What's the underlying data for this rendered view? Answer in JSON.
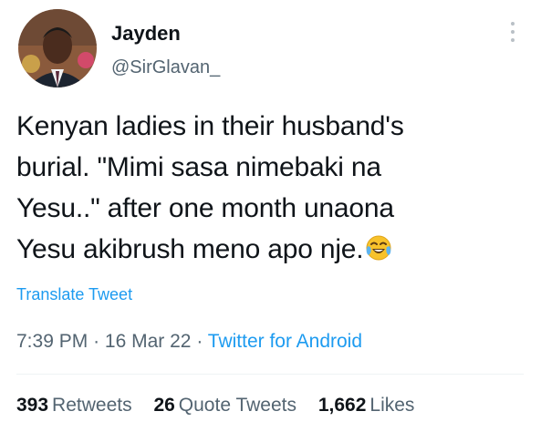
{
  "author": {
    "name": "Jayden",
    "handle": "@SirGlavan_",
    "avatar_icon": "profile-photo"
  },
  "more_icon": "vertical-dots-icon",
  "tweet": {
    "lines": [
      "Kenyan ladies in their husband's",
      "burial. \"Mimi sasa nimebaki na",
      "Yesu..\" after one month unaona",
      "Yesu akibrush meno apo nje."
    ],
    "emoji": "face-with-tears-of-joy"
  },
  "translate_label": "Translate Tweet",
  "meta": {
    "time": "7:39 PM",
    "separator": "·",
    "date": "16 Mar 22",
    "source": "Twitter for Android"
  },
  "stats": {
    "retweets_count": "393",
    "retweets_label": "Retweets",
    "quotes_count": "26",
    "quotes_label": "Quote Tweets",
    "likes_count": "1,662",
    "likes_label": "Likes"
  },
  "colors": {
    "text": "#0f1419",
    "secondary": "#536471",
    "link": "#1d9bf0",
    "divider": "#eff3f4"
  }
}
